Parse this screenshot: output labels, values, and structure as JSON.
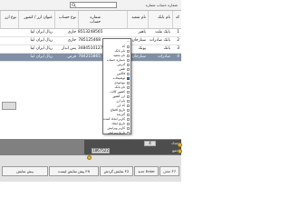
{
  "topbar": {
    "search_placeholder": "",
    "right_label": "شماره حساب شماره"
  },
  "grid": {
    "columns": [
      "کد",
      "نام بانک",
      "نام شعبه",
      "شماره حساب",
      "نوع حساب",
      "عنوان ارز / کشور",
      "نوع ارز"
    ],
    "rows": [
      {
        "code": "1",
        "bank": "بانک ملت",
        "branch": "باهنر",
        "account": "851324856532",
        "type": "جاری",
        "currency": "ریال ایران ایتا",
        "selected": false
      },
      {
        "code": "2",
        "bank": "بانک صادرات",
        "branch": "ستارخان",
        "account": "785125468",
        "type": "جاری",
        "currency": "ریال ایران ایتا",
        "selected": false
      },
      {
        "code": "3",
        "bank": "بانک",
        "branch": "پونک",
        "account": "348451012765",
        "type": "پس انداز",
        "currency": "ریال ایران ایتا",
        "selected": false
      },
      {
        "code": "4",
        "bank": "صادرات",
        "branch": "ستارخان",
        "account": "784215865",
        "type": "قرض",
        "currency": "ریال ایران ایتا",
        "selected": true
      }
    ]
  },
  "chooser": {
    "title": "...",
    "items": [
      {
        "label": "کد",
        "checked": false
      },
      {
        "label": "نام بانک",
        "checked": false
      },
      {
        "label": "نام شعبه",
        "checked": false
      },
      {
        "label": "شماره حساب",
        "checked": false
      },
      {
        "label": "آدرس",
        "checked": false
      },
      {
        "label": "تلفن",
        "checked": false
      },
      {
        "label": "فاکس",
        "checked": false
      },
      {
        "label": "توضیحات",
        "checked": true
      },
      {
        "label": "موجودی",
        "checked": false
      },
      {
        "label": "نام بانک",
        "checked": false
      },
      {
        "label": "کشور کالت",
        "checked": false
      },
      {
        "label": "ارز کشور",
        "checked": false
      },
      {
        "label": "نام ارز",
        "checked": false
      },
      {
        "label": "کد ارز",
        "checked": false
      },
      {
        "label": "تاریخ افتتاح",
        "checked": false
      },
      {
        "label": "گیرنده",
        "checked": false
      },
      {
        "label": "کاربر ایجاد کننده",
        "checked": false
      },
      {
        "label": "تاریخ ایجاد",
        "checked": false
      },
      {
        "label": "کاربر ویرایش",
        "checked": false
      },
      {
        "label": "تاریخ ویرایش",
        "checked": false
      }
    ]
  },
  "summary": {
    "label": "جمع",
    "count_label": "تعداد",
    "count_value": "4",
    "total_value": "1867522"
  },
  "toolbar": {
    "buttons": [
      {
        "label": "حذف F7",
        "name": "delete-f7-button"
      },
      {
        "label": "جدید Enter",
        "name": "new-enter-button"
      },
      {
        "label": "نمایش گردش F2",
        "name": "show-turnover-f2-button"
      },
      {
        "label": "پیش نمایش لیست F9",
        "name": "preview-list-f9-button"
      },
      {
        "label": "پیش نمایش",
        "name": "preview-button"
      }
    ]
  },
  "colors": {
    "selected_row": "#7f8fa6",
    "accent": "#e1b92f"
  }
}
